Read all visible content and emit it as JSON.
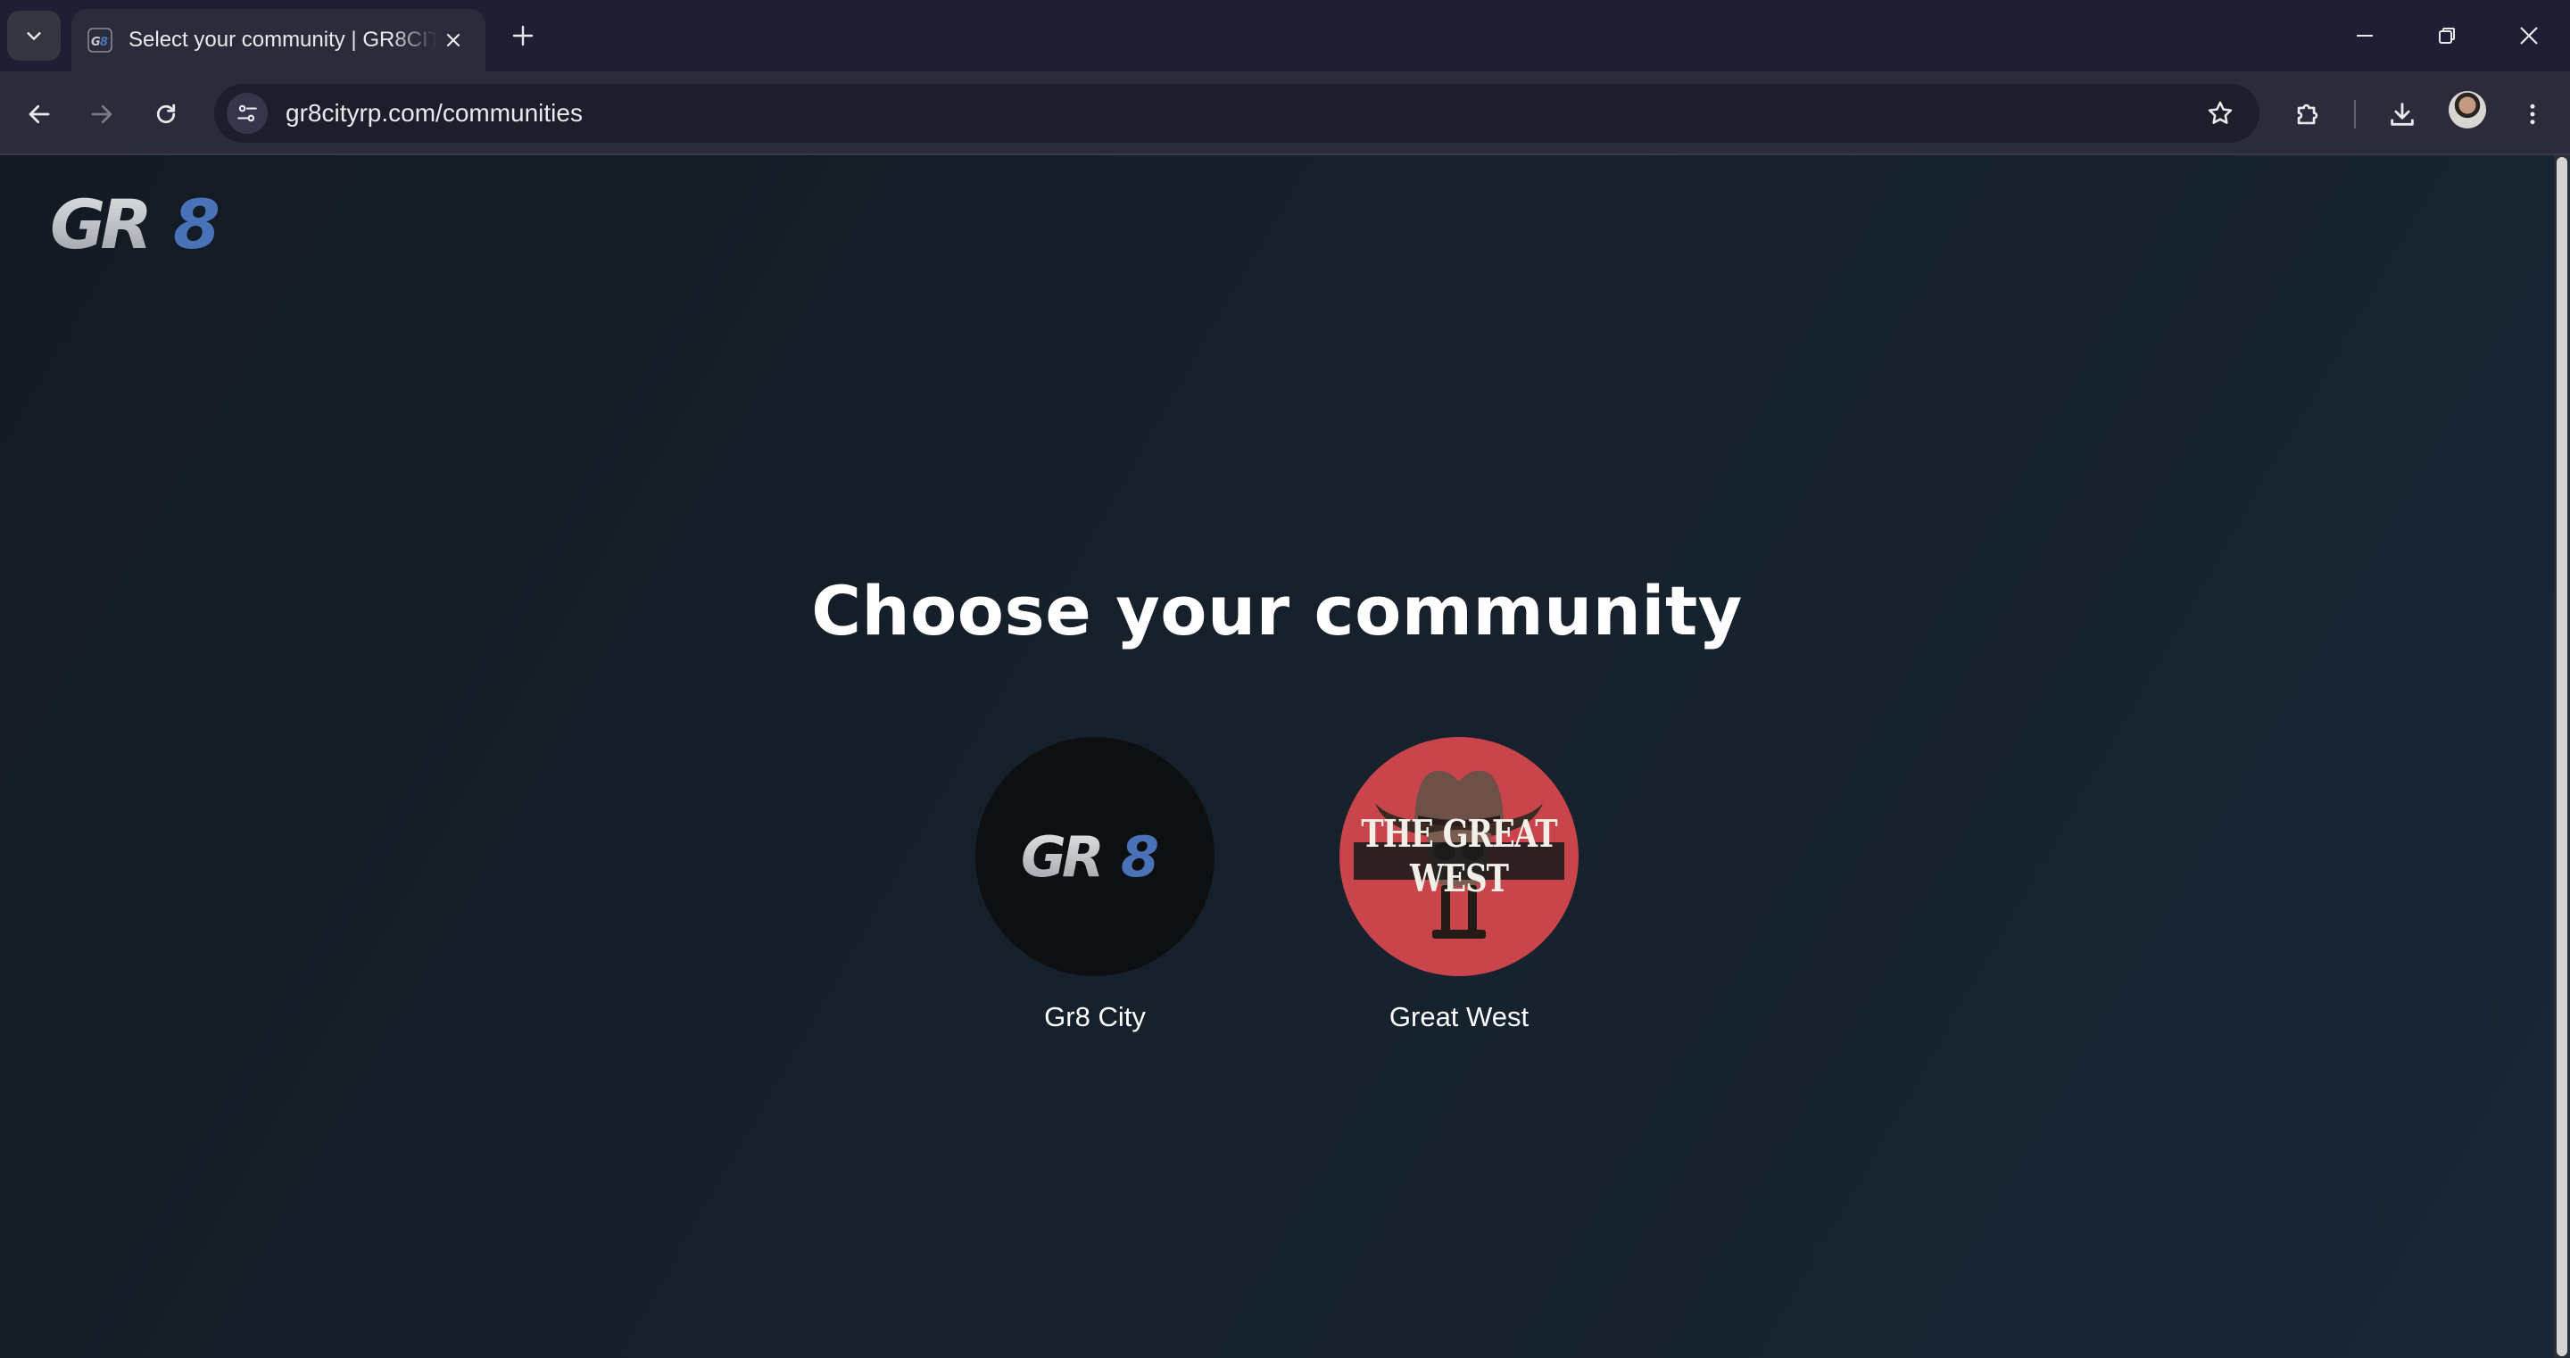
{
  "browser": {
    "tab": {
      "title": "Select your community | GR8CITY"
    },
    "address_bar": {
      "url": "gr8cityrp.com/communities"
    },
    "icons": {
      "tab_search": "chevron-down-icon",
      "new_tab": "plus-icon",
      "minimize": "minimize-icon",
      "restore": "restore-icon",
      "close_window": "close-icon",
      "back": "arrow-left-icon",
      "forward": "arrow-right-icon",
      "reload": "reload-icon",
      "site_info": "tune-icon",
      "bookmark": "star-icon",
      "extensions": "puzzle-icon",
      "downloads": "download-icon",
      "menu": "kebab-menu-icon"
    }
  },
  "page": {
    "logo": "GR8",
    "heading": "Choose your community",
    "communities": [
      {
        "name": "Gr8 City",
        "logo_text": "GR8",
        "background": "#0e0f11"
      },
      {
        "name": "Great West",
        "logo_text": "THE GREAT WEST",
        "background": "#c9444b"
      }
    ]
  },
  "colors": {
    "page_background": "#15202b",
    "brand_silver": "#c7c9cc",
    "brand_blue": "#4a72b8",
    "chrome_tabstrip": "#1f1f33",
    "chrome_toolbar": "#2b2b3c"
  }
}
